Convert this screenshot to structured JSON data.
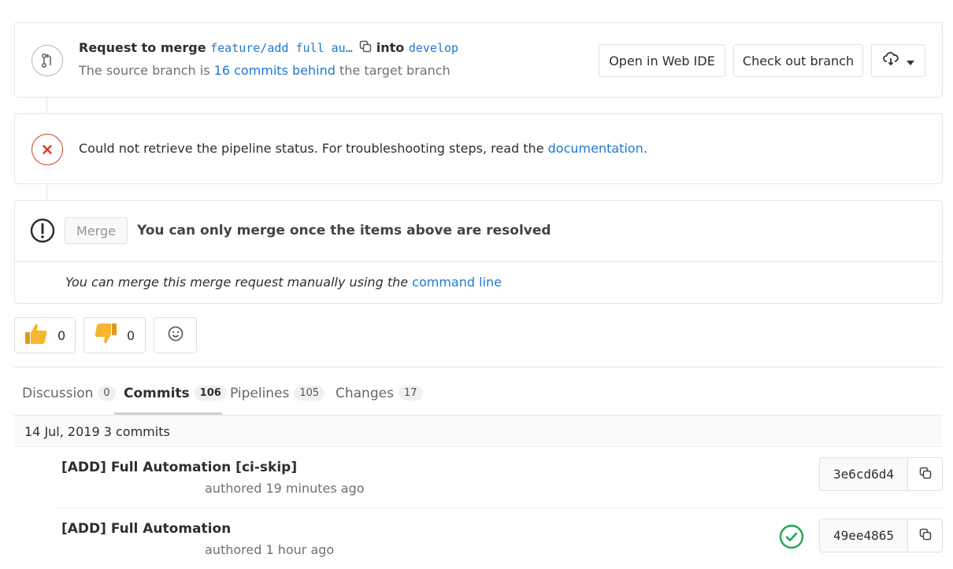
{
  "merge_request": {
    "title_prefix": "Request to merge",
    "source_branch": "feature/add full au…",
    "into_label": "into",
    "target_branch": "develop",
    "sub_prefix": "The source branch is",
    "behind_link": "16 commits behind",
    "sub_suffix": "the target branch",
    "open_web_ide": "Open in Web IDE",
    "checkout_branch": "Check out branch"
  },
  "pipeline": {
    "message": "Could not retrieve the pipeline status. For troubleshooting steps, read the",
    "doc_link": "documentation."
  },
  "merge": {
    "button_label": "Merge",
    "message": "You can only merge once the items above are resolved",
    "manual_text": "You can merge this merge request manually using the",
    "manual_link": "command line"
  },
  "awards": {
    "thumbs_up_count": "0",
    "thumbs_down_count": "0"
  },
  "tabs": [
    {
      "label": "Discussion",
      "count": "0"
    },
    {
      "label": "Commits",
      "count": "106"
    },
    {
      "label": "Pipelines",
      "count": "105"
    },
    {
      "label": "Changes",
      "count": "17"
    }
  ],
  "commits": {
    "day_header": "14 Jul, 2019 3 commits",
    "items": [
      {
        "title": "[ADD] Full Automation [ci-skip]",
        "meta": "authored 19 minutes ago",
        "sha": "3e6cd6d4"
      },
      {
        "title": "[ADD] Full Automation",
        "meta": "authored 1 hour ago",
        "sha": "49ee4865"
      }
    ]
  },
  "colors": {
    "link": "#1f78d1",
    "error": "#db3b21",
    "success": "#1aaa55",
    "thumb": "#f6b72f"
  }
}
